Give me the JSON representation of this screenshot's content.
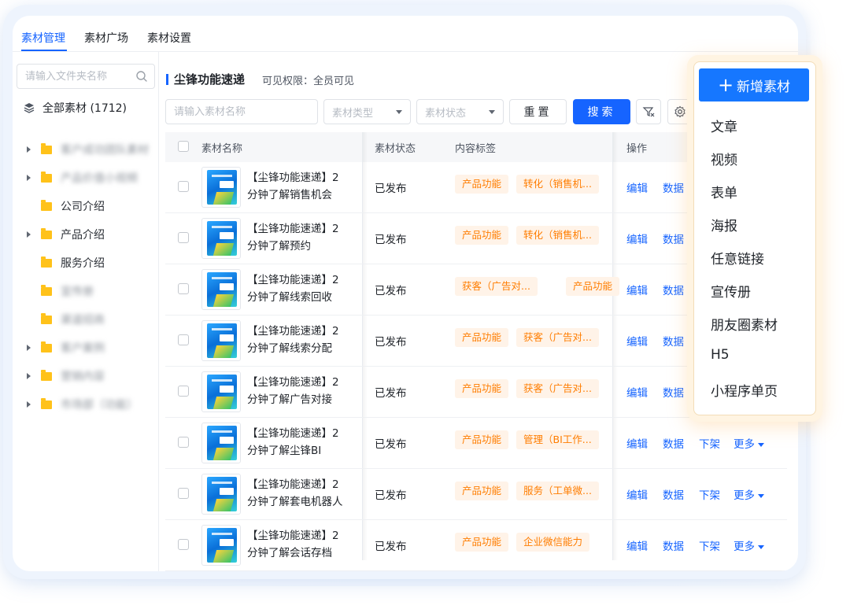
{
  "tabs": [
    {
      "label": "素材管理"
    },
    {
      "label": "素材广场"
    },
    {
      "label": "素材设置"
    }
  ],
  "sidebar": {
    "search_placeholder": "请输入文件夹名称",
    "all_label": "全部素材 (1712)",
    "folders": [
      {
        "label": "客户成功团队素材",
        "blurred": true,
        "expandable": true
      },
      {
        "label": "产品价值小视频",
        "blurred": true,
        "expandable": true
      },
      {
        "label": "公司介绍",
        "blurred": false,
        "expandable": false
      },
      {
        "label": "产品介绍",
        "blurred": false,
        "expandable": true
      },
      {
        "label": "服务介绍",
        "blurred": false,
        "expandable": false
      },
      {
        "label": "宣传册",
        "blurred": true,
        "expandable": false
      },
      {
        "label": "渠道招商",
        "blurred": true,
        "expandable": false
      },
      {
        "label": "客户案例",
        "blurred": true,
        "expandable": true
      },
      {
        "label": "营销内容",
        "blurred": true,
        "expandable": true
      },
      {
        "label": "市场部（功能）",
        "blurred": true,
        "expandable": true
      }
    ]
  },
  "header": {
    "title": "尘锋功能速递",
    "visibility": "可见权限：全员可见"
  },
  "filters": {
    "name_placeholder": "请输入素材名称",
    "type_placeholder": "素材类型",
    "status_placeholder": "素材状态",
    "reset_label": "重置",
    "search_label": "搜索"
  },
  "table": {
    "columns": {
      "name": "素材名称",
      "status": "素材状态",
      "tags": "内容标签",
      "ops": "操作"
    },
    "rows": [
      {
        "title_line1": "【尘锋功能速递】2",
        "title_line2": "分钟了解销售机会",
        "status": "已发布",
        "tags": [
          "产品功能",
          "转化（销售机..."
        ]
      },
      {
        "title_line1": "【尘锋功能速递】2",
        "title_line2": "分钟了解预约",
        "status": "已发布",
        "tags": [
          "产品功能",
          "转化（销售机..."
        ]
      },
      {
        "title_line1": "【尘锋功能速递】2",
        "title_line2": "分钟了解线索回收",
        "status": "已发布",
        "tags": [
          "获客（广告对...",
          "产品功能"
        ]
      },
      {
        "title_line1": "【尘锋功能速递】2",
        "title_line2": "分钟了解线索分配",
        "status": "已发布",
        "tags": [
          "产品功能",
          "获客（广告对..."
        ]
      },
      {
        "title_line1": "【尘锋功能速递】2",
        "title_line2": "分钟了解广告对接",
        "status": "已发布",
        "tags": [
          "产品功能",
          "获客（广告对..."
        ]
      },
      {
        "title_line1": "【尘锋功能速递】2",
        "title_line2": "分钟了解尘锋BI",
        "status": "已发布",
        "tags": [
          "产品功能",
          "管理（BI工作..."
        ]
      },
      {
        "title_line1": "【尘锋功能速递】2",
        "title_line2": "分钟了解套电机器人",
        "status": "已发布",
        "tags": [
          "产品功能",
          "服务（工单微..."
        ]
      },
      {
        "title_line1": "【尘锋功能速递】2",
        "title_line2": "分钟了解会话存档",
        "status": "已发布",
        "tags": [
          "产品功能",
          "企业微信能力"
        ]
      }
    ],
    "ops": {
      "edit": "编辑",
      "data": "数据",
      "offline": "下架",
      "more": "更多"
    }
  },
  "menu": {
    "add_label": "新增素材",
    "items": [
      "文章",
      "视频",
      "表单",
      "海报",
      "任意链接",
      "宣传册",
      "朋友圈素材",
      "H5",
      "小程序单页"
    ]
  },
  "colors": {
    "accent": "#1664ff",
    "tag_bg": "#fff3e8",
    "tag_text": "#ff7d00",
    "folder": "#ffc21a"
  }
}
